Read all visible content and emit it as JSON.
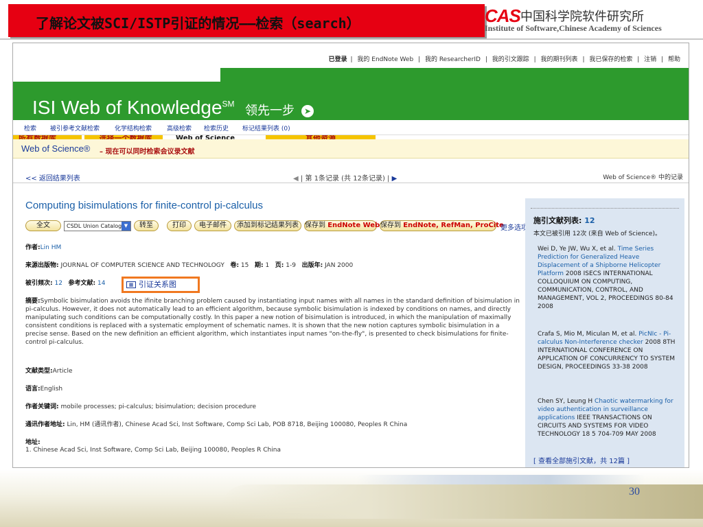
{
  "slide": {
    "title": "了解论文被SCI/ISTP引证的情况——检索（search）",
    "logo_mark": "CAS",
    "logo_cn": "中国科学院软件研究所",
    "logo_en": "Institute of Software,Chinese Academy of Sciences",
    "page_number": "30"
  },
  "toplinks": [
    "已登录",
    "我的 EndNote Web",
    "我的 ResearcherID",
    "我的引文跟踪",
    "我的期刊列表",
    "我已保存的检索",
    "注销",
    "帮助"
  ],
  "header": {
    "brand": "ISI Web of Knowledge",
    "brand_sup": "SM",
    "slogan": "领先一步",
    "slogan_icon": "arrow-circle-icon"
  },
  "tabs": [
    "所有数据库",
    "选择一个数据库",
    "Web of Science",
    "其他资源"
  ],
  "subnav": [
    "检索",
    "被引参考文献检索",
    "化学结构检索",
    "高级检索",
    "检索历史",
    "标记结果列表 (0)"
  ],
  "wos": {
    "title": "Web of Science®",
    "subtitle": "– 现在可以同时检索会议录文献"
  },
  "nav": {
    "back": "<< 返回结果列表",
    "record": "第 1条记录 (共 12条记录)",
    "right": "Web of Science® 中的记录"
  },
  "article": {
    "title": "Computing bisimulations for finite-control pi-calculus",
    "buttons": {
      "fulltext": "全文",
      "catalog": "CSDL Union Catalog",
      "goto": "转至",
      "print": "打印",
      "email": "电子邮件",
      "add_marked": "添加到标记结果列表",
      "save_to": "保存到",
      "endnote_web": "EndNote Web",
      "save_to2": "保存到",
      "endnote_refman": "EndNote, RefMan, ProCite",
      "more": "更多选项"
    },
    "author_label": "作者:",
    "author": "Lin HM",
    "source_label": "来源出版物:",
    "source": "JOURNAL OF COMPUTER SCIENCE AND TECHNOLOGY",
    "volume_label": "卷:",
    "volume": "15",
    "issue_label": "期:",
    "issue": "1",
    "pages_label": "页:",
    "pages": "1-9",
    "year_label": "出版年:",
    "year": "JAN 2000",
    "cited_label": "被引频次:",
    "cited": "12",
    "refs_label": "参考文献:",
    "refs": "14",
    "cite_map": "引证关系图",
    "abstract_label": "摘要:",
    "abstract": "Symbolic bisimulation avoids the ifinite branching problem caused by instantiating input names with all names in the standard definition of bisimulation in pi-calculus. However, it does not automatically lead to an efficient algorithm, because symbolic bisimulation is indexed by conditions on names, and directly manipulating such conditions can be computationally costly. In this paper a new notion of bisimulation is introduced, in which the manipulation of maximally consistent conditions is replaced with a systematic employment of schematic names. It is shown that the new notion captures symbolic bisimulation in a precise sense. Based on the new definition an efficient algorithm, which instantiates input names \"on-the-fly\", is presented to check bisimulations for finite-control pi-calculus.",
    "doctype_label": "文献类型:",
    "doctype": "Article",
    "lang_label": "语言:",
    "lang": "English",
    "keywords_label": "作者关键词:",
    "keywords": "mobile processes; pi-calculus; bisimulation; decision procedure",
    "corr_label": "通讯作者地址:",
    "corr": "Lin, HM (通讯作者), Chinese Acad Sci, Inst Software, Comp Sci Lab, POB 8718, Beijing 100080, Peoples R China",
    "addr_label": "地址:",
    "addr": "1. Chinese Acad Sci, Inst Software, Comp Sci Lab, Beijing 100080, Peoples R China"
  },
  "sidebar": {
    "heading": "施引文献列表:",
    "count": "12",
    "sub": "本文已被引用 12次 (来自 Web of Science)。",
    "citing": [
      {
        "authors": "Wei D, Ye JW, Wu X, et al.",
        "title": "Time Series Prediction for Generalized Heave Displacement of a Shipborne Helicopter Platform",
        "source": "2008 ISECS INTERNATIONAL COLLOQUIUM ON COMPUTING, COMMUNICATION, CONTROL, AND MANAGEMENT, VOL 2, PROCEEDINGS 80-84 2008"
      },
      {
        "authors": "Crafa S, Mio M, Miculan M, et al.",
        "title": "PicNIc - Pi-calculus Non-Interference checker",
        "source": "2008 8TH INTERNATIONAL CONFERENCE ON APPLICATION OF CONCURRENCY TO SYSTEM DESIGN, PROCEEDINGS 33-38 2008"
      },
      {
        "authors": "Chen SY, Leung H",
        "title": "Chaotic watermarking for video authentication in surveillance applications",
        "source": "IEEE TRANSACTIONS ON CIRCUITS AND SYSTEMS FOR VIDEO TECHNOLOGY 18 5 704-709 MAY 2008"
      }
    ],
    "view_all": "[ 查看全部施引文献，共 12篇 ]"
  },
  "colors": {
    "title_bar": "#e60012",
    "isi_green": "#2d9a2d",
    "tab_yellow": "#f5c400",
    "link_blue": "#1a5fa8",
    "highlight_orange": "#f07820",
    "sidebar_bg": "#dce6f2"
  }
}
